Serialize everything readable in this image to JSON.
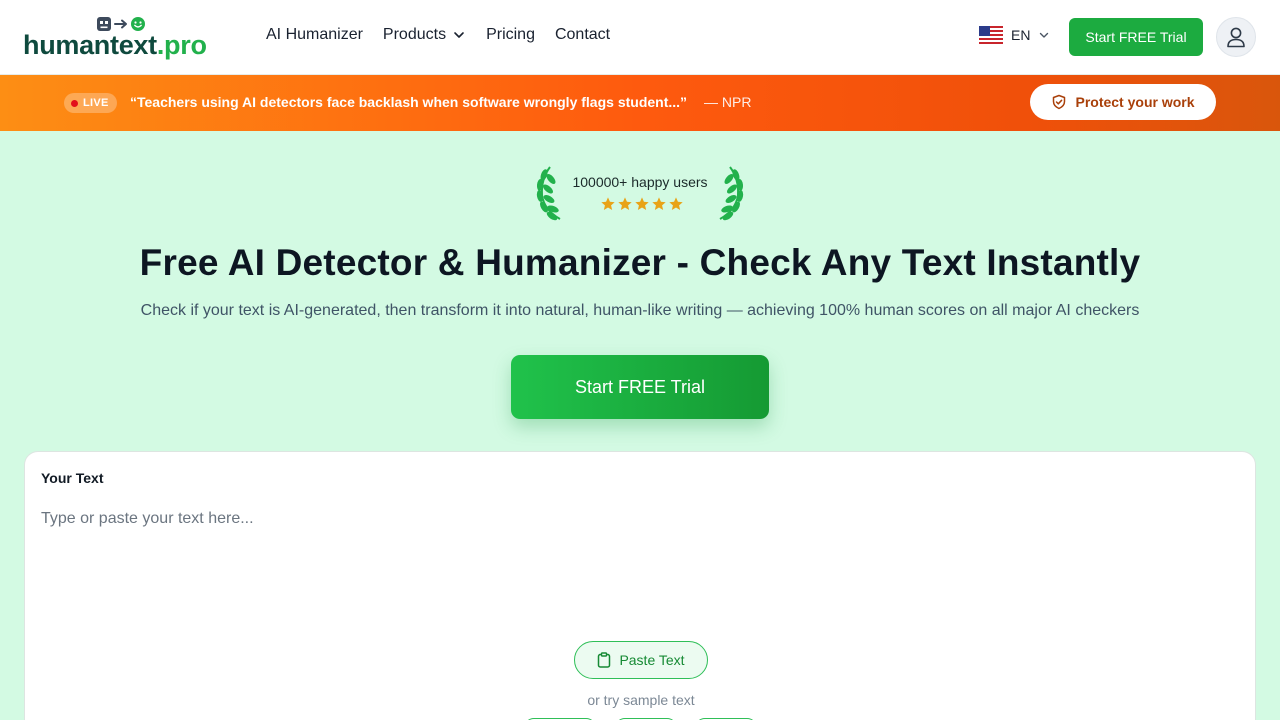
{
  "header": {
    "logo": {
      "part1": "human",
      "part2": "text",
      "part3": ".pro"
    },
    "nav": [
      {
        "label": "AI Humanizer"
      },
      {
        "label": "Products",
        "dropdown": true
      },
      {
        "label": "Pricing"
      },
      {
        "label": "Contact"
      }
    ],
    "language": "EN",
    "cta_label": "Start FREE Trial"
  },
  "banner": {
    "live_label": "LIVE",
    "quote": "“Teachers using AI detectors face backlash when software wrongly flags student...”",
    "source": "— NPR",
    "cta_label": "Protect your work"
  },
  "hero": {
    "badge_text": "100000+ happy users",
    "rating": {
      "value": 5,
      "max": 5
    },
    "title": "Free AI Detector & Humanizer - Check Any Text Instantly",
    "subtitle": "Check if your text is AI-generated, then transform it into natural, human-like writing — achieving 100% human scores on all major AI checkers",
    "cta_label": "Start FREE Trial"
  },
  "editor": {
    "label": "Your Text",
    "value": "",
    "placeholder": "Type or paste your text here...",
    "paste_label": "Paste Text",
    "sample_prompt": "or try sample text"
  },
  "colors": {
    "brand_green": "#1cab40",
    "brand_dark": "#0f4a3e",
    "page_bg": "#d3fae3",
    "banner_orange": "#fe5a0e",
    "star": "#e8a317"
  },
  "icons": {
    "logo": [
      "robot-face-icon",
      "arrow-right-icon",
      "smile-face-icon"
    ],
    "nav_dropdown": "chevron-down-icon",
    "language": "us-flag-icon",
    "account": "user-icon",
    "protect": "shield-check-icon",
    "badge": "laurel-wreath-icon",
    "paste": "clipboard-icon"
  }
}
